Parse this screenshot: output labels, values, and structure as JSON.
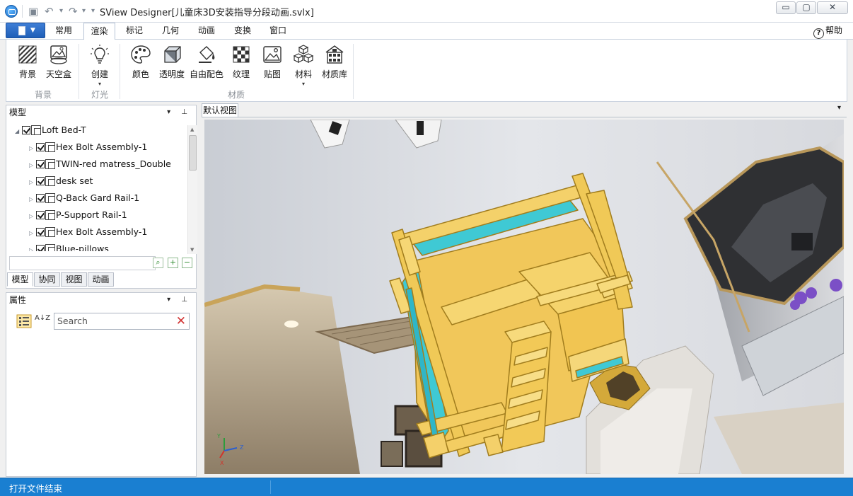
{
  "window": {
    "title": "SView Designer[儿童床3D安装指导分段动画.svlx]",
    "min_label": "▭",
    "max_label": "▢",
    "close_label": "✕"
  },
  "quick_access": {
    "save": "▣",
    "undo": "↶",
    "undo_more": "▾",
    "redo": "↷",
    "redo_more": "▾",
    "customize": "▾"
  },
  "ribbon_tabs": [
    "常用",
    "渲染",
    "标记",
    "几何",
    "动画",
    "变换",
    "窗口"
  ],
  "active_tab": "渲染",
  "help_label": "帮助",
  "help_icon": "?",
  "ribbon": {
    "groups": [
      "背景",
      "灯光",
      "材质"
    ],
    "buttons": [
      "背景",
      "天空盒",
      "创建",
      "颜色",
      "透明度",
      "自由配色",
      "纹理",
      "贴图",
      "材料",
      "材质库"
    ],
    "dropdown_mark": "▾"
  },
  "model_panel": {
    "title": "模型",
    "tools": "▾ ⊥",
    "tree": [
      {
        "label": "Loft Bed-T",
        "expanded": true
      },
      {
        "label": "Hex Bolt Assembly-1"
      },
      {
        "label": "TWIN-red matress_Double"
      },
      {
        "label": "desk set"
      },
      {
        "label": "Q-Back Gard Rail-1"
      },
      {
        "label": "P-Support Rail-1"
      },
      {
        "label": "Hex Bolt Assembly-1"
      },
      {
        "label": "Blue-pillows"
      }
    ],
    "search_buttons": [
      "⌕",
      "+",
      "−"
    ],
    "tabs": [
      "模型",
      "协同",
      "视图",
      "动画"
    ],
    "active_tab": "模型"
  },
  "property_panel": {
    "title": "属性",
    "tools": "▾ ⊥",
    "search_placeholder": "Search",
    "clear_icon": "✕",
    "sort_icon": "A↓Z"
  },
  "viewport": {
    "tab_label": "默认视图",
    "menu_icon": "▾",
    "axis_labels": {
      "x": "X",
      "y": "Y",
      "z": "Z"
    },
    "colors": {
      "bed_wood": "#f2cc5a",
      "bed_edge": "#b38a22",
      "mattress": "#3fc9d4"
    }
  },
  "status": {
    "text": "打开文件结束"
  }
}
